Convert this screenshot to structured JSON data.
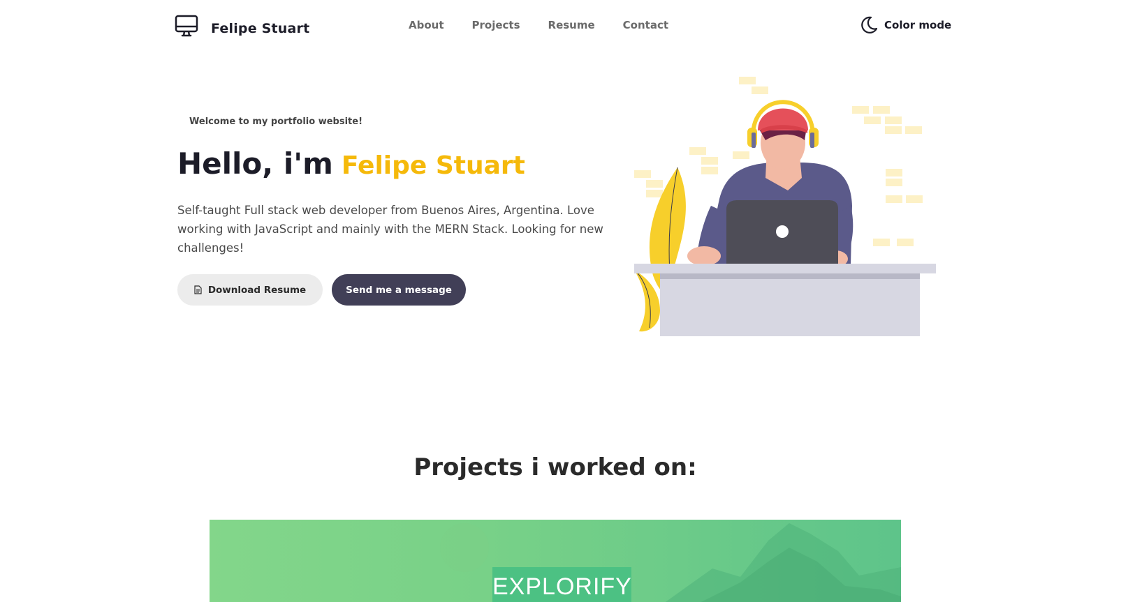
{
  "header": {
    "brand_name": "Felipe Stuart",
    "brand_icon": "monitor-icon",
    "nav": [
      {
        "label": "About"
      },
      {
        "label": "Projects"
      },
      {
        "label": "Resume"
      },
      {
        "label": "Contact"
      }
    ],
    "color_mode_label": "Color mode",
    "color_mode_icon": "moon-icon"
  },
  "hero": {
    "welcome": "Welcome to my portfolio website!",
    "greeting": "Hello, i'm",
    "name": "Felipe Stuart",
    "description": "Self-taught Full stack web developer from Buenos Aires, Argentina. Love working with JavaScript and mainly with the MERN Stack. Looking for new challenges!",
    "download_button": "Download Resume",
    "download_icon": "document-icon",
    "message_button": "Send me a message"
  },
  "projects": {
    "title": "Projects i worked on:",
    "items": [
      {
        "label": "EXPLORIFY"
      }
    ]
  },
  "colors": {
    "accent": "#f5b90a",
    "dark_button": "#413f57",
    "light_button": "#ececec",
    "project_green": "#4cc183"
  }
}
